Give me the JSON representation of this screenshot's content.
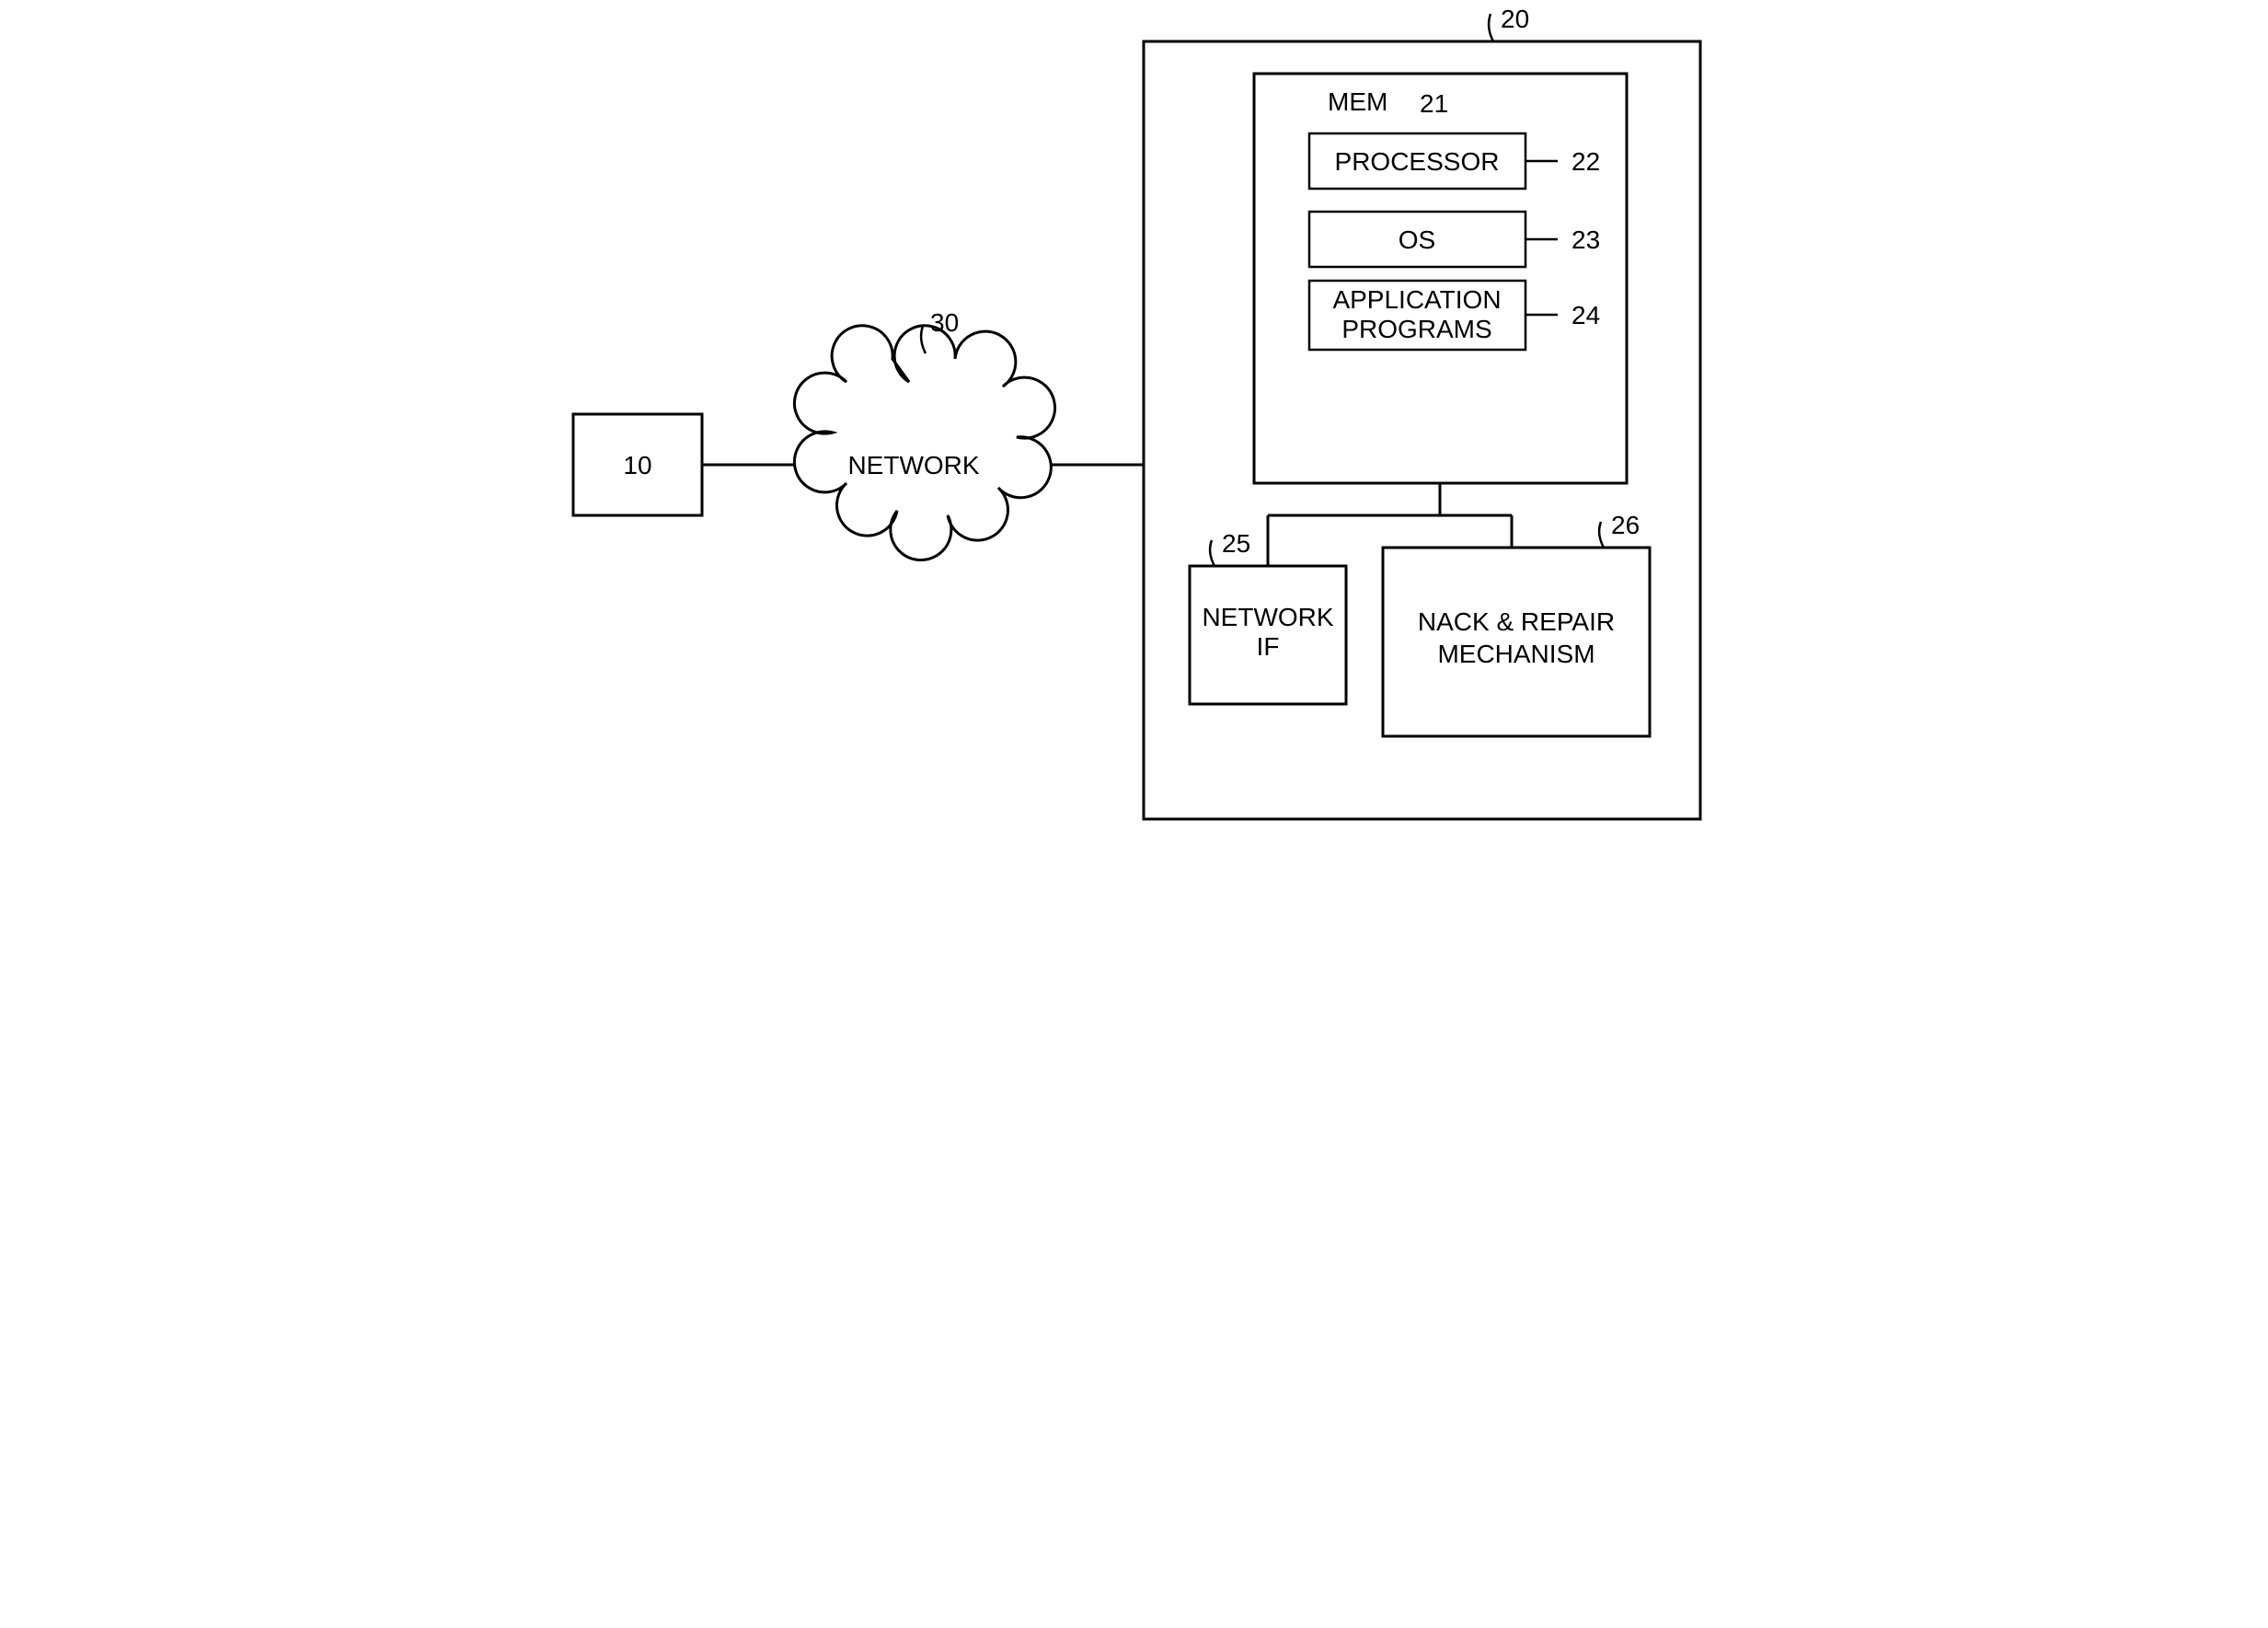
{
  "block10": {
    "label": "10"
  },
  "block30": {
    "label": "NETWORK",
    "ref": "30"
  },
  "block20": {
    "ref": "20"
  },
  "mem": {
    "label": "MEM",
    "ref": "21"
  },
  "proc": {
    "label": "PROCESSOR",
    "ref": "22"
  },
  "os": {
    "label": "OS",
    "ref": "23"
  },
  "apps": {
    "label_line1": "APPLICATION",
    "label_line2": "PROGRAMS",
    "ref": "24"
  },
  "netif": {
    "label_line1": "NETWORK",
    "label_line2": "IF",
    "ref": "25"
  },
  "nack": {
    "label_line1": "NACK & REPAIR",
    "label_line2": "MECHANISM",
    "ref": "26"
  }
}
